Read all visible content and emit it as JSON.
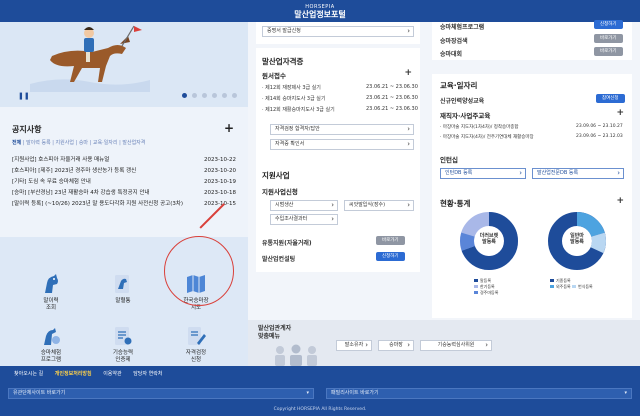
{
  "header": {
    "logo_en": "HORSEPIA",
    "logo_kr": "말산업정보포털"
  },
  "hero": {
    "pause_label": "❚❚"
  },
  "notice": {
    "title": "공지사항",
    "plus": "+",
    "tabs": [
      "전체",
      "말이력 등록",
      "지원사업",
      "승마",
      "교육·일자리",
      "말산업자격"
    ],
    "items": [
      {
        "text": "[지원사업] 호스피아 자율거래 사용 매뉴얼",
        "date": "2023-10-22"
      },
      {
        "text": "[호스피아] [제주] 2023년 경주마 생산농가 등록 갱신",
        "date": "2023-10-20"
      },
      {
        "text": "[기타] 도심 속 무료 승마체험 안내",
        "date": "2023-10-19"
      },
      {
        "text": "[승마] [부산경남] 23년 재활승마 4차 강습생 특정공지 안내",
        "date": "2023-10-18"
      },
      {
        "text": "[말이력 등록] (~10/26) 2023년 말 용도다각화 지원 사전신청 공고(3차)",
        "date": "2023-10-15"
      }
    ]
  },
  "quick": [
    {
      "label": "말이력\n조회"
    },
    {
      "label": "말혈통"
    },
    {
      "label": "한국승마장\n지도"
    },
    {
      "label": "승마체험\n프로그램"
    },
    {
      "label": "기승능력\n인증제"
    },
    {
      "label": "자격검정\n신청"
    }
  ],
  "mid": {
    "cert_btn": "증명서 발급신청",
    "qual_title": "말산업자격증",
    "apply_title": "원서접수",
    "apply_plus": "+",
    "apply_rows": [
      {
        "text": "· 제12회 재장제사 3급 실기",
        "date": "23.06.21 ~ 23.06.30"
      },
      {
        "text": "· 제14회 승마지도사 3급 실기",
        "date": "23.06.21 ~ 23.06.30"
      },
      {
        "text": "· 제12회 재활승마지도사 3급 실기",
        "date": "23.06.21 ~ 23.06.30"
      }
    ],
    "exam_result_btn": "자격검정 합격자/답안",
    "qual_check_btn": "자격증 확인서",
    "support_title": "지원사업",
    "support_apply": "지원사업신청",
    "support_btns": [
      "시범생산",
      "씨앗말입식(장수)",
      "수입조사결과터"
    ],
    "trade_label": "유통지원(자율거래)",
    "trade_btn": "바로가기",
    "cert_label": "말산업컨설팅",
    "cert_btn2": "신청하기"
  },
  "right": {
    "top_rows": [
      {
        "text": "승마체험프로그램",
        "btn": "신청하기",
        "btn_type": "blue"
      },
      {
        "text": "승마장검색",
        "btn": "바로가기",
        "btn_type": "gray"
      },
      {
        "text": "승마대회",
        "btn": "바로가기",
        "btn_type": "gray"
      }
    ],
    "edu_title": "교육·일자리",
    "edu_new": "신규인력양성교육",
    "edu_new_btn": "참여신청",
    "edu_re": "재직자·사업주교육",
    "edu_plus": "+",
    "edu_rows": [
      {
        "text": "· 마장마술 지도자(1차4차)/ 정착승마종합",
        "date": "23.09.06 ~ 23.10.27"
      },
      {
        "text": "· 마장마술 지도자(4차)/ 전주기연대체 재활승마장",
        "date": "23.09.06 ~ 23.12.03"
      }
    ],
    "intern_title": "인턴십",
    "intern_btns": [
      "인턴DB 등록",
      "말산업전문DB 등록"
    ],
    "stats_title": "현황·통계",
    "stats_plus": "+",
    "donut1": {
      "center": "더러브렛\n말등록",
      "legend": [
        "말등록",
        "한기등록",
        "경주마등록"
      ]
    },
    "donut2": {
      "center": "일반마\n말등록",
      "legend": [
        "기종등록",
        "외주등록",
        "번식등록"
      ]
    }
  },
  "bottom": {
    "title": "말산업관계자\n맞춤메뉴",
    "tabs": [
      "말소유자",
      "승마장",
      "기승능력심사위원"
    ]
  },
  "footer": {
    "links": [
      "찾아오시는 길",
      "개인정보처리방침",
      "이용약관",
      "담당자 연락처"
    ],
    "related1": "유관단체사이트 바로가기",
    "related2": "패밀리사이트 바로가기",
    "copyright": "Copyright HORSEPIA All Rights Reserved."
  },
  "colors": {
    "primary": "#1e4c9a",
    "accent_red": "#d9403a",
    "button_blue": "#2c6bd3"
  }
}
